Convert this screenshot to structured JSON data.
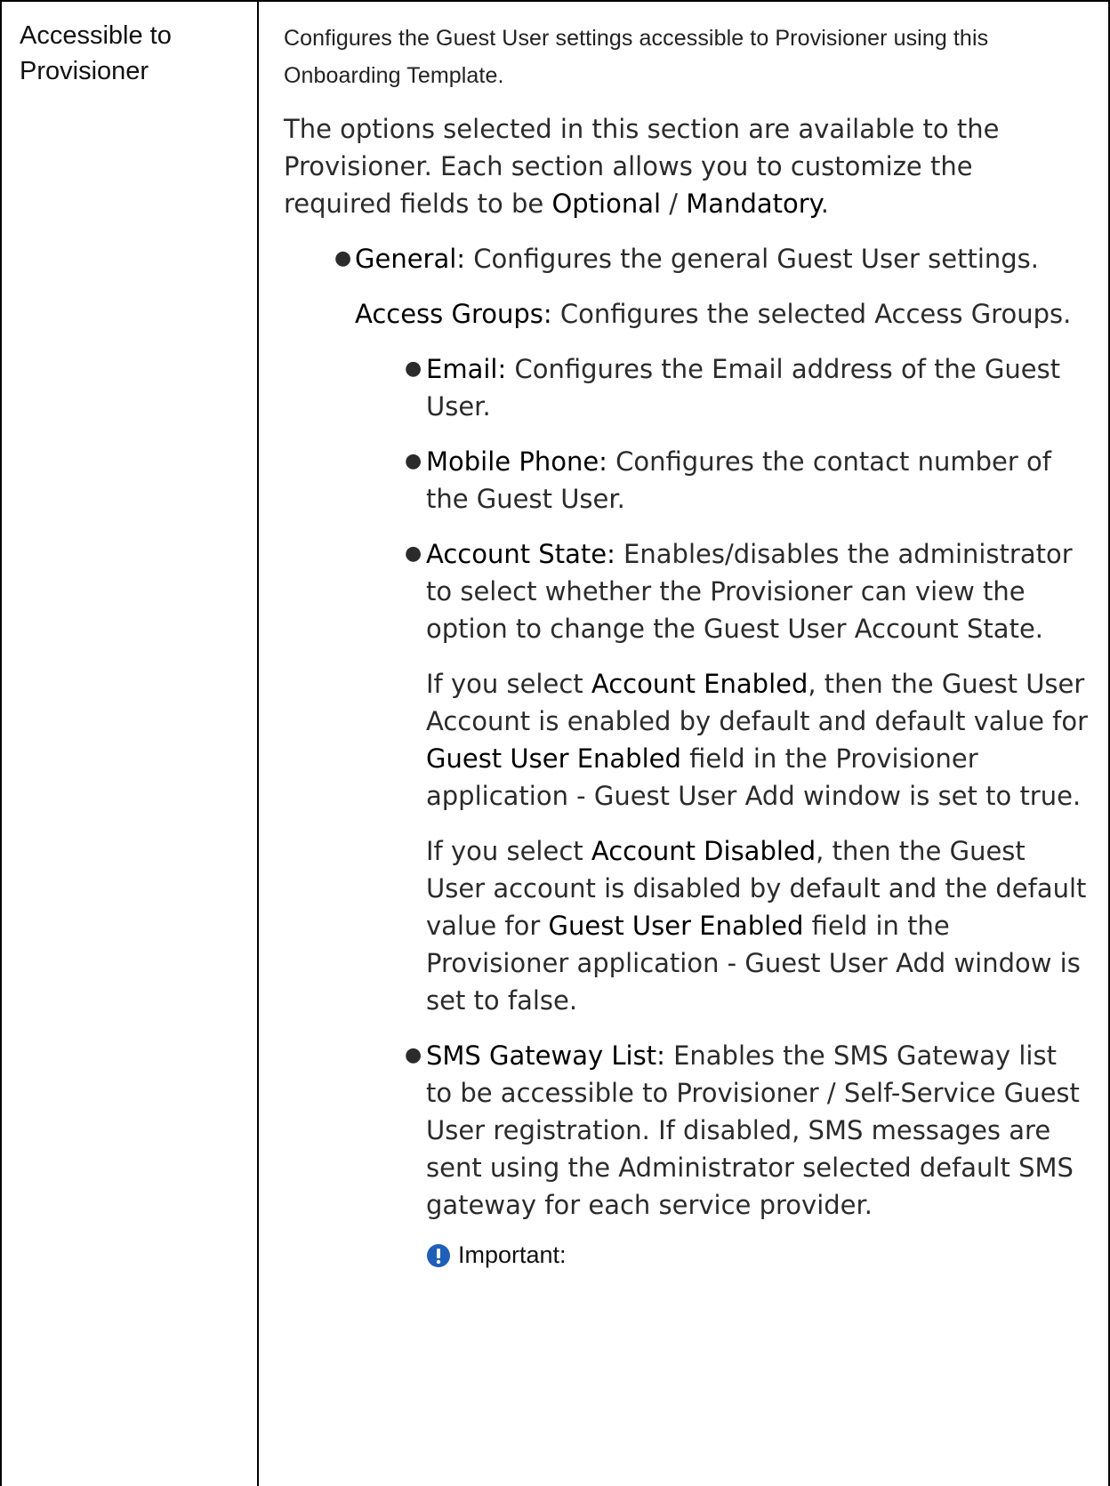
{
  "table": {
    "row_label": "Accessible to Provisioner",
    "intro": "Configures the Guest User settings accessible to Provisioner using this Onboarding Template.",
    "options_text": {
      "pre": "The options selected in this section are available to the Provisioner. Each section allows you to customize the required fields to be ",
      "optional": "Optional",
      "sep": " / ",
      "mandatory": "Mandatory",
      "post": "."
    },
    "general": {
      "label": "General:",
      "text": " Configures the general Guest User settings."
    },
    "access_groups": {
      "label": "Access Groups:",
      "text": " Configures the selected Access Groups."
    },
    "email": {
      "label": "Email:",
      "text": " Configures the Email address of the Guest User."
    },
    "mobile_phone": {
      "label": "Mobile Phone:",
      "text": " Configures the contact number of the Guest User."
    },
    "account_state": {
      "label": "Account State:",
      "text": " Enables/disables the administrator to select whether the Provisioner can view the option to change the Guest User Account State."
    },
    "enabled_para": {
      "pre": "If you select ",
      "b1": "Account Enabled",
      "mid": ", then the Guest User Account is enabled by default and default value for ",
      "b2": "Guest User Enabled",
      "post": " field in the Provisioner application - Guest User Add window is set to true."
    },
    "disabled_para": {
      "pre": "If you select ",
      "b1": "Account Disabled",
      "mid": ", then the Guest User account is disabled by default and the default value for ",
      "b2": "Guest User Enabled",
      "post": " field in the Provisioner application - Guest User Add window is set to false."
    },
    "sms": {
      "label": "SMS Gateway List:",
      "text": " Enables the SMS Gateway list to be accessible to Provisioner / Self-Service Guest User registration. If disabled, SMS messages are sent using the Administrator selected default SMS gateway for each service provider."
    },
    "important_label": "Important:",
    "important_icon": "exclamation-circle-icon",
    "icon_color": "#1f5fb8"
  }
}
